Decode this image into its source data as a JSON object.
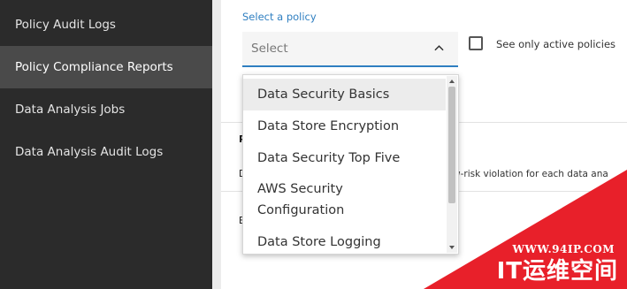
{
  "sidebar": {
    "items": [
      {
        "label": "Policy Audit Logs"
      },
      {
        "label": "Policy Compliance Reports"
      },
      {
        "label": "Data Analysis Jobs"
      },
      {
        "label": "Data Analysis Audit Logs"
      }
    ]
  },
  "filters": {
    "policy_label": "Select a policy",
    "select_placeholder": "Select",
    "active_only_label": "See only active policies"
  },
  "dropdown": {
    "options": [
      {
        "label": "Data Security Basics"
      },
      {
        "label": "Data Store Encryption"
      },
      {
        "label": "Data Security Top Five"
      },
      {
        "label": "AWS Security Configuration",
        "line1": "AWS Security",
        "line2": "Configuration"
      },
      {
        "label": "Data Store Logging"
      }
    ]
  },
  "table": {
    "header_fragment": "P",
    "row1_fragment": "D",
    "row1_desc_fragment": "w-risk violation for each data ana",
    "row2_fragment": "E"
  },
  "watermark": {
    "url": "WWW.94IP.COM",
    "name": "IT运维空间"
  },
  "colors": {
    "sidebar_bg": "#2b2b2b",
    "sidebar_active": "#4a4a4a",
    "accent": "#2f7fc1",
    "watermark": "#e8202a"
  }
}
